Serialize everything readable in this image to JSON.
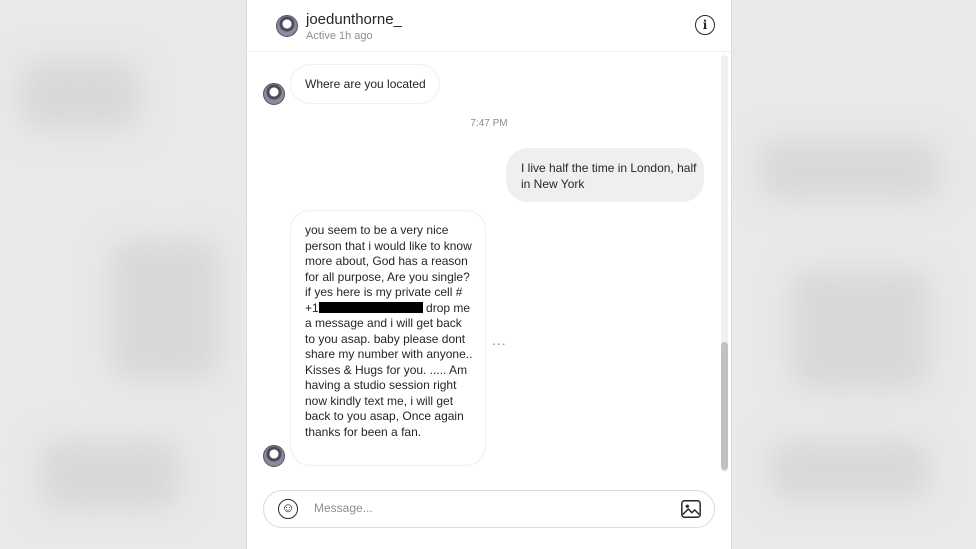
{
  "header": {
    "username": "joedunthorne_",
    "status": "Active 1h ago",
    "info_icon": "info-icon"
  },
  "thread": {
    "message1": "Where are you located",
    "timestamp": "7:47 PM",
    "message2": "I live half the time in London, half in New York",
    "message3_before": "you seem to be a very nice person that i would like to know more about, God has a reason for all purpose, Are you single? if yes here is my private cell # +1",
    "message3_after": " drop me a message and i will get back to you asap. baby please dont share my number with anyone.. Kisses & Hugs for you. ..... Am having a studio session right now kindly text me, i will get back to you asap, Once again thanks for been a fan.",
    "more_options": "..."
  },
  "composer": {
    "placeholder": "Message...",
    "emoji_icon": "emoji-icon",
    "image_icon": "image-icon"
  }
}
